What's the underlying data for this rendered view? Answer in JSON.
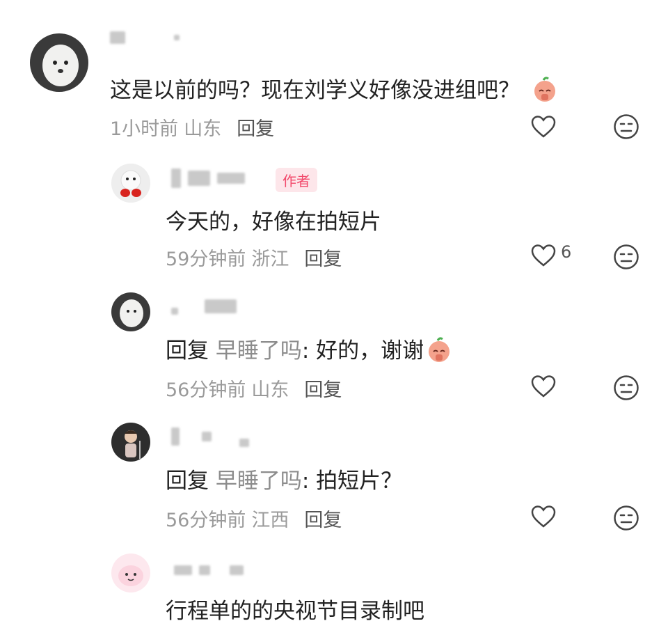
{
  "comments": [
    {
      "text": "这是以前的吗？现在刘学义好像没进组吧？",
      "time": "1小时前",
      "region": "山东",
      "reply_label": "回复",
      "likes": ""
    },
    {
      "badge": "作者",
      "text": "今天的，好像在拍短片",
      "time": "59分钟前",
      "region": "浙江",
      "reply_label": "回复",
      "likes": "6"
    },
    {
      "reply_prefix": "回复",
      "reply_target": "早睡了吗",
      "text": ": 好的，谢谢",
      "time": "56分钟前",
      "region": "山东",
      "reply_label": "回复",
      "likes": ""
    },
    {
      "reply_prefix": "回复",
      "reply_target": "早睡了吗",
      "text": ": 拍短片？",
      "time": "56分钟前",
      "region": "江西",
      "reply_label": "回复",
      "likes": ""
    },
    {
      "text": "行程单的的央视节目录制吧"
    }
  ],
  "icons": {
    "like": "heart-outline-icon",
    "dislike": "neutral-face-icon",
    "emoji": "praying-peach-emoji-icon"
  },
  "colors": {
    "badge_bg": "#fde6ea",
    "badge_text": "#f2496b",
    "meta_text": "#9a9a9a"
  }
}
